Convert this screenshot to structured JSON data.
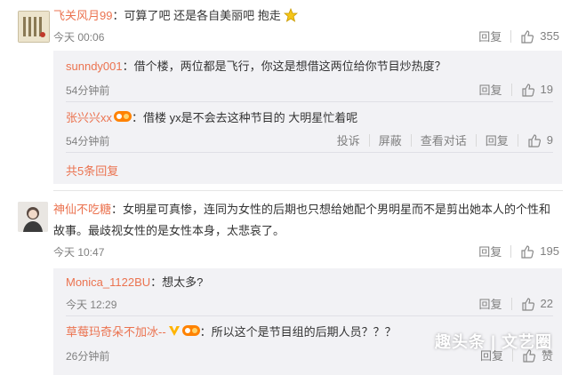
{
  "comments": [
    {
      "username": "飞关风月99",
      "text": "：可算了吧 还是各自美丽吧 抱走",
      "time": "今天 00:06",
      "reply_label": "回复",
      "likes": "355",
      "avatar_text": "",
      "replies": [
        {
          "username": "sunndy001",
          "text": "：借个楼，两位都是飞行，你这是想借这两位给你节目炒热度？",
          "time": "54分钟前",
          "reply_label": "回复",
          "likes": "19"
        },
        {
          "username": "张兴兴xx",
          "text": "：借楼 yx是不会去这种节目的 大明星忙着呢",
          "time": "54分钟前",
          "report_label": "投诉",
          "block_label": "屏蔽",
          "view_thread_label": "查看对话",
          "reply_label": "回复",
          "likes": "9"
        }
      ],
      "more_replies": "共5条回复"
    },
    {
      "username": "神仙不吃糖",
      "text": "：女明星可真惨，连同为女性的后期也只想给她配个男明星而不是剪出她本人的个性和故事。最歧视女性的是女性本身，太悲哀了。",
      "time": "今天 10:47",
      "reply_label": "回复",
      "likes": "195",
      "replies": [
        {
          "username": "Monica_1122BU",
          "text": "：想太多?",
          "time": "今天 12:29",
          "reply_label": "回复",
          "likes": "22"
        },
        {
          "username": "草莓玛奇朵不加冰--",
          "text": "：所以这个是节目组的后期人员？？？",
          "time": "26分钟前",
          "reply_label": "回复",
          "likes": "赞"
        }
      ]
    }
  ],
  "watermark": "趣头条 | 文艺圈",
  "colors": {
    "username": "#eb7350",
    "meta": "#808080",
    "reply_bg": "#f2f2f5"
  }
}
